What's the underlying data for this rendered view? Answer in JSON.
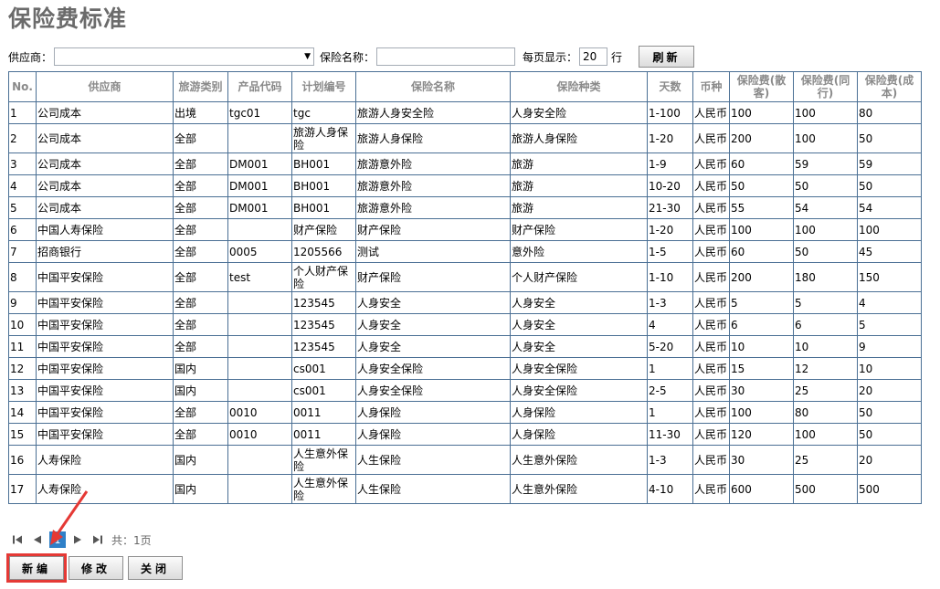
{
  "page_title": "保险费标准",
  "filters": {
    "supplier_label": "供应商：",
    "supplier_value": "",
    "insurance_name_label": "保险名称：",
    "insurance_name_value": "",
    "per_page_label": "每页显示：",
    "per_page_value": "20",
    "per_page_unit": "行",
    "refresh_label": "刷新"
  },
  "table": {
    "headers": [
      "No.",
      "供应商",
      "旅游类别",
      "产品代码",
      "计划编号",
      "保险名称",
      "保险种类",
      "天数",
      "币种",
      "保险费(散客)",
      "保险费(同行)",
      "保险费(成本)"
    ],
    "rows": [
      [
        "1",
        "公司成本",
        "出境",
        "tgc01",
        "tgc",
        "旅游人身安全险",
        "人身安全险",
        "1-100",
        "人民币",
        "100",
        "100",
        "80"
      ],
      [
        "2",
        "公司成本",
        "全部",
        "",
        "旅游人身保险",
        "旅游人身保险",
        "旅游人身保险",
        "1-20",
        "人民币",
        "200",
        "100",
        "50"
      ],
      [
        "3",
        "公司成本",
        "全部",
        "DM001",
        "BH001",
        "旅游意外险",
        "旅游",
        "1-9",
        "人民币",
        "60",
        "59",
        "59"
      ],
      [
        "4",
        "公司成本",
        "全部",
        "DM001",
        "BH001",
        "旅游意外险",
        "旅游",
        "10-20",
        "人民币",
        "50",
        "50",
        "50"
      ],
      [
        "5",
        "公司成本",
        "全部",
        "DM001",
        "BH001",
        "旅游意外险",
        "旅游",
        "21-30",
        "人民币",
        "55",
        "54",
        "54"
      ],
      [
        "6",
        "中国人寿保险",
        "全部",
        "",
        "财产保险",
        "财产保险",
        "财产保险",
        "1-20",
        "人民币",
        "100",
        "100",
        "100"
      ],
      [
        "7",
        "招商银行",
        "全部",
        "0005",
        "1205566",
        "测试",
        "意外险",
        "1-5",
        "人民币",
        "60",
        "50",
        "45"
      ],
      [
        "8",
        "中国平安保险",
        "全部",
        "test",
        "个人财产保险",
        "财产保险",
        "个人财产保险",
        "1-10",
        "人民币",
        "200",
        "180",
        "150"
      ],
      [
        "9",
        "中国平安保险",
        "全部",
        "",
        "123545",
        "人身安全",
        "人身安全",
        "1-3",
        "人民币",
        "5",
        "5",
        "4"
      ],
      [
        "10",
        "中国平安保险",
        "全部",
        "",
        "123545",
        "人身安全",
        "人身安全",
        "4",
        "人民币",
        "6",
        "6",
        "5"
      ],
      [
        "11",
        "中国平安保险",
        "全部",
        "",
        "123545",
        "人身安全",
        "人身安全",
        "5-20",
        "人民币",
        "10",
        "10",
        "9"
      ],
      [
        "12",
        "中国平安保险",
        "国内",
        "",
        "cs001",
        "人身安全保险",
        "人身安全保险",
        "1",
        "人民币",
        "15",
        "12",
        "10"
      ],
      [
        "13",
        "中国平安保险",
        "国内",
        "",
        "cs001",
        "人身安全保险",
        "人身安全保险",
        "2-5",
        "人民币",
        "30",
        "25",
        "20"
      ],
      [
        "14",
        "中国平安保险",
        "全部",
        "0010",
        "0011",
        "人身保险",
        "人身保险",
        "1",
        "人民币",
        "100",
        "80",
        "50"
      ],
      [
        "15",
        "中国平安保险",
        "全部",
        "0010",
        "0011",
        "人身保险",
        "人身保险",
        "11-30",
        "人民币",
        "120",
        "100",
        "50"
      ],
      [
        "16",
        "人寿保险",
        "国内",
        "",
        "人生意外保险",
        "人生保险",
        "人生意外保险",
        "1-3",
        "人民币",
        "30",
        "25",
        "20"
      ],
      [
        "17",
        "人寿保险",
        "国内",
        "",
        "人生意外保险",
        "人生保险",
        "人生意外保险",
        "4-10",
        "人民币",
        "600",
        "500",
        "500"
      ]
    ]
  },
  "pager": {
    "current_page": "1",
    "total_text": "共：1页"
  },
  "actions": {
    "new_label": "新编",
    "edit_label": "修改",
    "close_label": "关闭"
  },
  "colors": {
    "title": "#6b6b6b",
    "grid_border": "#4a6f94",
    "header_text": "#8a8a8a",
    "pager_current": "#2f80c8",
    "highlight": "#e53935"
  }
}
